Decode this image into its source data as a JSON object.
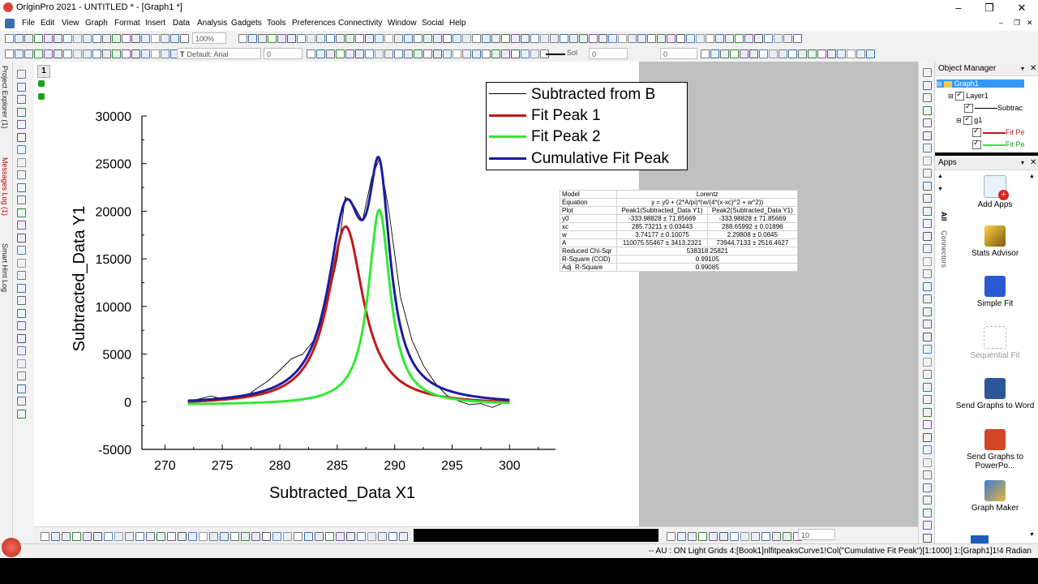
{
  "window": {
    "title": "OriginPro 2021 - UNTITLED * - [Graph1 *]"
  },
  "menu": [
    "File",
    "Edit",
    "View",
    "Graph",
    "Format",
    "Insert",
    "Data",
    "Analysis",
    "Gadgets",
    "Tools",
    "Preferences",
    "Connectivity",
    "Window",
    "Social",
    "Help"
  ],
  "toolbar": {
    "zoom": "100%",
    "font": "Default: Arial",
    "font_size": "0",
    "line_style": "Sol",
    "line_width": "0",
    "pattern_val": "0"
  },
  "left_dock": {
    "tabs": [
      "Project Explorer (1)",
      "Messages Log (1)",
      "Smart Hint Log"
    ],
    "layer_number": "1"
  },
  "legend": {
    "items": [
      "Subtracted from B",
      "Fit Peak 1",
      "Fit Peak 2",
      "Cumulative Fit Peak"
    ]
  },
  "colors": {
    "subtracted": "#000000",
    "peak1": "#c01a1a",
    "peak2": "#33e833",
    "cumulative": "#1b1ba0"
  },
  "results_table": {
    "model_label": "Model",
    "model": "Lorentz",
    "equation_label": "Equation",
    "equation": "y = y0 + (2*A/pi)*(w/(4*(x-xc)^2 + w^2))",
    "plot_label": "Plot",
    "plot1": "Peak1(Subtracted_Data Y1)",
    "plot2": "Peak2(Subtracted_Data Y1)",
    "params": [
      {
        "name": "y0",
        "v1": "-333.98828 ± 71.85669",
        "v2": "-333.98828 ± 71.85669"
      },
      {
        "name": "xc",
        "v1": "285.73211 ± 0.03443",
        "v2": "288.65992 ± 0.01896"
      },
      {
        "name": "w",
        "v1": "3.74177 ± 0.10075",
        "v2": "2.29808 ± 0.0645"
      },
      {
        "name": "A",
        "v1": "110075.55467 ± 3413.2321",
        "v2": "73944.7133 ± 2516.4627"
      }
    ],
    "stats": [
      {
        "name": "Reduced Chi-Sqr",
        "value": "538318.25821"
      },
      {
        "name": "R-Square (COD)",
        "value": "0.99105"
      },
      {
        "name": "Adj. R-Square",
        "value": "0.99085"
      }
    ]
  },
  "chart_data": {
    "type": "line",
    "xlabel": "Subtracted_Data X1",
    "ylabel": "Subtracted_Data Y1",
    "xlim": [
      268,
      304
    ],
    "ylim": [
      -5000,
      30000
    ],
    "xticks": [
      270,
      275,
      280,
      285,
      290,
      295,
      300
    ],
    "yticks": [
      -5000,
      0,
      5000,
      10000,
      15000,
      20000,
      25000,
      30000
    ],
    "series": [
      {
        "name": "Subtracted from B",
        "x": [
          272,
          273,
          274,
          275,
          276,
          277,
          278,
          279,
          280,
          281,
          282,
          283,
          284,
          285,
          285.7,
          286.5,
          287.2,
          288,
          288.7,
          289.5,
          290.5,
          291.5,
          292.5,
          293.5,
          294.5,
          295.5,
          296.5,
          297.5,
          298.5,
          299.5,
          300
        ],
        "y": [
          0,
          300,
          600,
          300,
          400,
          500,
          1400,
          2200,
          3300,
          4500,
          5000,
          6500,
          9500,
          15000,
          21500,
          20500,
          19000,
          23500,
          25600,
          20000,
          11000,
          6500,
          3800,
          2000,
          700,
          100,
          -300,
          -200,
          -600,
          -100,
          0
        ]
      },
      {
        "name": "Fit Peak 1",
        "x": [],
        "y": []
      },
      {
        "name": "Fit Peak 2",
        "x": [],
        "y": []
      },
      {
        "name": "Cumulative Fit Peak",
        "x": [],
        "y": []
      }
    ]
  },
  "object_manager": {
    "title": "Object Manager",
    "items": [
      "Graph1",
      "Layer1",
      "Subtrac",
      "g1",
      "Fit Pe",
      "Fit Pe"
    ]
  },
  "apps_panel": {
    "title": "Apps",
    "tabs": [
      "All",
      "Connectors"
    ],
    "items": [
      "Add Apps",
      "Stats Advisor",
      "Simple Fit",
      "Sequential Fit",
      "Send Graphs to Word",
      "Send Graphs to PowerPo...",
      "Graph Maker"
    ]
  },
  "bottom_toolbar": {
    "size": "10"
  },
  "status": {
    "text": "--   AU : ON  Light Grids  4:[Book1]nlfitpeaksCurve1!Col(\"Cumulative Fit Peak\")[1:1000]  1:[Graph1]1!4  Radian"
  }
}
